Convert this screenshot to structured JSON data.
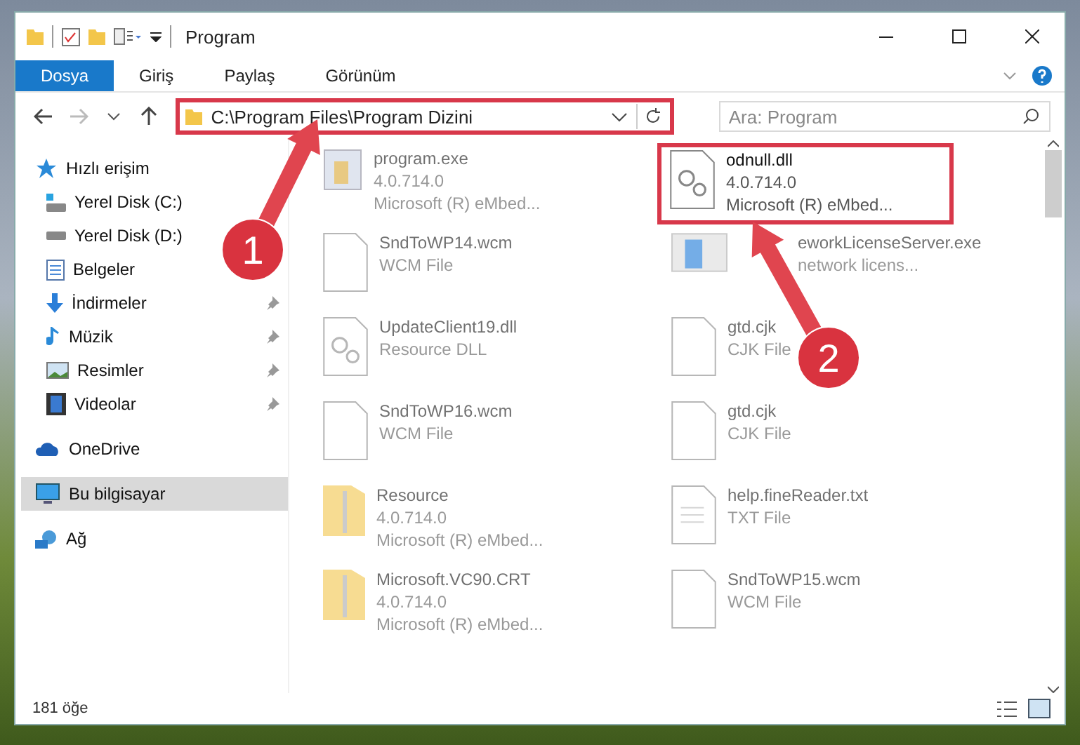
{
  "window": {
    "title": "Program"
  },
  "ribbon_tabs": [
    {
      "label": "Dosya",
      "selected": true
    },
    {
      "label": "Giriş",
      "selected": false
    },
    {
      "label": "Paylaş",
      "selected": false
    },
    {
      "label": "Görünüm",
      "selected": false
    }
  ],
  "address": {
    "path": "C:\\Program Files\\Program Dizini",
    "highlighted": true
  },
  "search": {
    "placeholder": "Ara: Program"
  },
  "sidebar": [
    {
      "label": "Hızlı erişim",
      "kind": "star",
      "selected": false,
      "children": [
        {
          "label": "Yerel Disk (C:)",
          "kind": "system-drive",
          "pinned": false,
          "selected": false
        },
        {
          "label": "Yerel Disk (D:)",
          "kind": "drive",
          "pinned": false,
          "selected": false
        },
        {
          "label": "Belgeler",
          "kind": "documents",
          "pinned": false,
          "selected": false
        },
        {
          "label": "İndirmeler",
          "kind": "download",
          "pinned": true,
          "selected": false
        },
        {
          "label": "Müzik",
          "kind": "music",
          "pinned": true,
          "selected": false
        },
        {
          "label": "Resimler",
          "kind": "pictures",
          "pinned": true,
          "selected": false
        },
        {
          "label": "Videolar",
          "kind": "video",
          "pinned": true,
          "selected": false
        }
      ]
    },
    {
      "label": "OneDrive",
      "kind": "cloud",
      "selected": false
    },
    {
      "label": "Bu bilgisayar",
      "kind": "computer",
      "selected": true
    },
    {
      "label": "Ağ",
      "kind": "network",
      "selected": false
    }
  ],
  "files": [
    {
      "name": "program.exe",
      "details": [
        "4.0.714.0",
        "Microsoft (R) eMbed..."
      ],
      "kind": "app",
      "dimmed": true,
      "highlighted": false
    },
    {
      "name": "odnull.dll",
      "details": [
        "4.0.714.0",
        "Microsoft (R) eMbed..."
      ],
      "kind": "dll",
      "dimmed": false,
      "highlighted": true
    },
    {
      "name": "SndToWP14.wcm",
      "details": [
        "WCM File"
      ],
      "kind": "file",
      "dimmed": true,
      "highlighted": false
    },
    {
      "name": "eworkLicenseServer.exe",
      "details": [
        "network licens..."
      ],
      "kind": "window-app",
      "dimmed": true,
      "highlighted": false
    },
    {
      "name": "UpdateClient19.dll",
      "details": [
        "Resource DLL"
      ],
      "kind": "dll",
      "dimmed": true,
      "highlighted": false
    },
    {
      "name": "gtd.cjk",
      "details": [
        "CJK File"
      ],
      "kind": "file",
      "dimmed": true,
      "highlighted": false
    },
    {
      "name": "SndToWP16.wcm",
      "details": [
        "WCM File"
      ],
      "kind": "file",
      "dimmed": true,
      "highlighted": false
    },
    {
      "name": "gtd.cjk",
      "details": [
        "CJK File"
      ],
      "kind": "file",
      "dimmed": true,
      "highlighted": false
    },
    {
      "name": "Resource",
      "details": [
        "4.0.714.0",
        "Microsoft (R) eMbed..."
      ],
      "kind": "folder-zip",
      "dimmed": true,
      "highlighted": false
    },
    {
      "name": "help.fineReader.txt",
      "details": [
        "TXT File"
      ],
      "kind": "text",
      "dimmed": true,
      "highlighted": false
    },
    {
      "name": "Microsoft.VC90.CRT",
      "details": [
        "4.0.714.0",
        "Microsoft (R) eMbed..."
      ],
      "kind": "folder-zip",
      "dimmed": true,
      "highlighted": false
    },
    {
      "name": "SndToWP15.wcm",
      "details": [
        "WCM File"
      ],
      "kind": "file",
      "dimmed": true,
      "highlighted": false
    }
  ],
  "status_bar": {
    "count": "181 öğe"
  },
  "callouts": [
    {
      "number": "1"
    },
    {
      "number": "2"
    }
  ]
}
